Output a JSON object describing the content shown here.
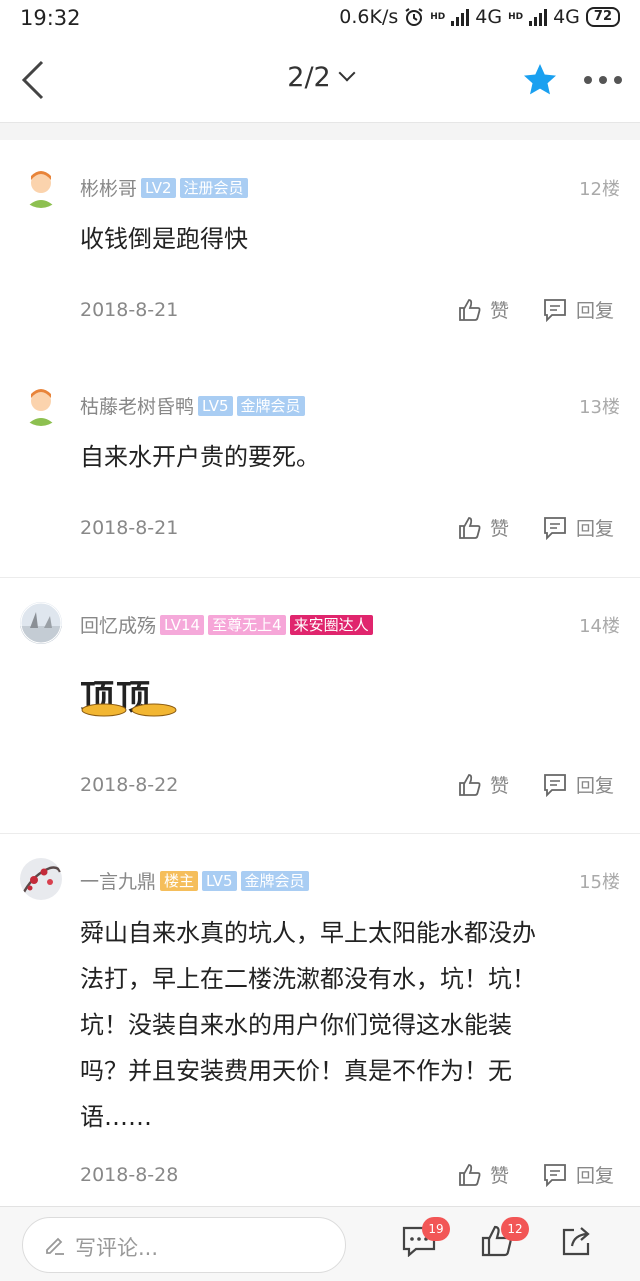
{
  "status_bar": {
    "time": "19:32",
    "net_speed": "0.6K/s",
    "network1": "4G",
    "network2": "4G",
    "battery": "72"
  },
  "header": {
    "page_indicator": "2/2",
    "accent_color": "#1aa0f0"
  },
  "posts": [
    {
      "username": "彬彬哥",
      "badges": [
        "LV2",
        "注册会员"
      ],
      "floor": "12楼",
      "content": "收钱倒是跑得快",
      "date": "2018-8-21",
      "like_label": "赞",
      "reply_label": "回复"
    },
    {
      "username": "枯藤老树昏鸭",
      "badges": [
        "LV5",
        "金牌会员"
      ],
      "floor": "13楼",
      "content": "自来水开户贵的要死。",
      "date": "2018-8-21",
      "like_label": "赞",
      "reply_label": "回复"
    },
    {
      "username": "回忆成殇",
      "badges": [
        "LV14",
        "至尊无上4",
        "来安圈达人"
      ],
      "floor": "14楼",
      "sticker_text": "顶顶",
      "date": "2018-8-22",
      "like_label": "赞",
      "reply_label": "回复"
    },
    {
      "username": "一言九鼎",
      "badges": [
        "楼主",
        "LV5",
        "金牌会员"
      ],
      "floor": "15楼",
      "content_lines": [
        "舜山自来水真的坑人，早上太阳能水都没办",
        "法打，早上在二楼洗漱都没有水，坑！坑！",
        "坑！没装自来水的用户你们觉得这水能装",
        "吗？并且安装费用天价！真是不作为！无",
        "语……"
      ],
      "date": "2018-8-28",
      "like_label": "赞",
      "reply_label": "回复"
    }
  ],
  "bottom_bar": {
    "comment_placeholder": "写评论...",
    "comment_count": "19",
    "like_count": "12"
  }
}
